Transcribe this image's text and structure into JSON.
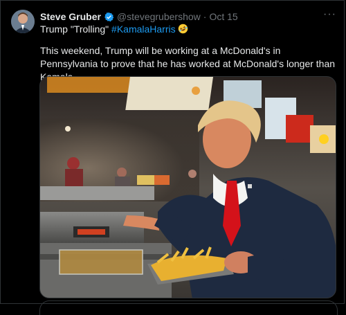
{
  "post": {
    "author_name": "Steve Gruber",
    "handle": "@stevegrubershow",
    "separator": "·",
    "date": "Oct 15",
    "line1_prefix": "Trump \"Trolling\" ",
    "hashtag": "#KamalaHarris",
    "body": "This weekend, Trump will be working at a McDonald's in Pennsylvania to prove that he has worked at McDonald's longer than Kamala.",
    "more_label": "···"
  },
  "icons": {
    "verified": "verified-badge-icon",
    "emoji": "rolling-on-floor-laughing-emoji",
    "more": "more-options-icon"
  },
  "colors": {
    "background": "#000000",
    "text": "#e7e9ea",
    "muted": "#71767b",
    "accent": "#1d9bf0"
  }
}
